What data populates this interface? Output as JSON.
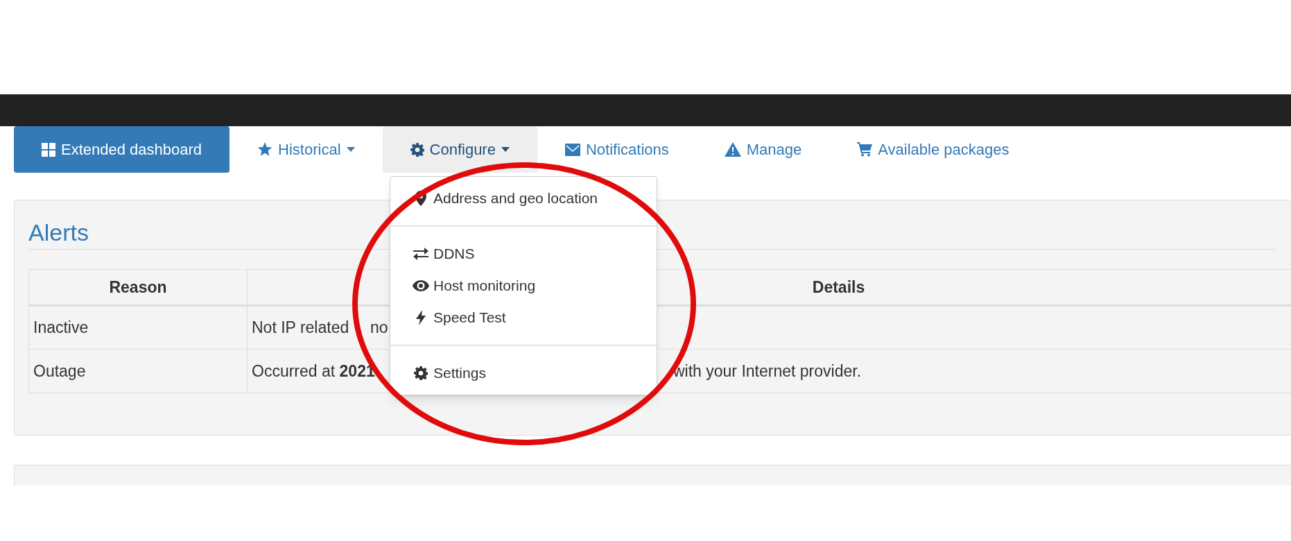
{
  "nav": [
    {
      "label": "Extended dashboard",
      "kind": "grid",
      "selected": true,
      "expanded": false,
      "caret": false
    },
    {
      "label": "Historical",
      "kind": "star",
      "selected": false,
      "expanded": false,
      "caret": true
    },
    {
      "label": "Configure",
      "kind": "gear",
      "selected": false,
      "expanded": true,
      "caret": true
    },
    {
      "label": "Notifications",
      "kind": "envelope",
      "selected": false,
      "expanded": false,
      "caret": false
    },
    {
      "label": "Manage",
      "kind": "warning",
      "selected": false,
      "expanded": false,
      "caret": false
    },
    {
      "label": "Available packages",
      "kind": "cart",
      "selected": false,
      "expanded": false,
      "caret": false
    }
  ],
  "dropdown": {
    "groups": [
      [
        {
          "label": "Address and geo location",
          "kind": "pin"
        }
      ],
      [
        {
          "label": "DDNS",
          "kind": "swap"
        },
        {
          "label": "Host monitoring",
          "kind": "eye"
        },
        {
          "label": "Speed Test",
          "kind": "bolt"
        }
      ],
      [
        {
          "label": "Settings",
          "kind": "gear"
        }
      ]
    ]
  },
  "alerts": {
    "title": "Alerts",
    "columns": [
      "Reason",
      "Details"
    ],
    "rows": [
      {
        "reason": "Inactive",
        "details": "Not IP related",
        "details_after": "no"
      },
      {
        "reason": "Outage",
        "details": "Occurred at **2021**",
        "details_after": "with your Internet provider."
      }
    ]
  },
  "annotation": {
    "kind": "ellipse"
  }
}
